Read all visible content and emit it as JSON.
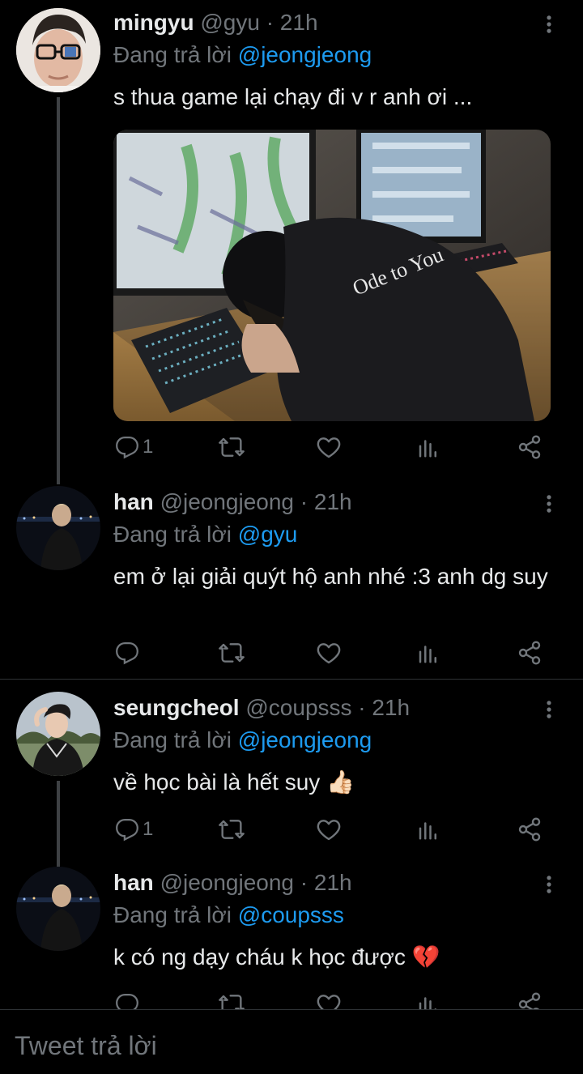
{
  "tweets": [
    {
      "name": "mingyu",
      "handle": "@gyu",
      "time": "· 21h",
      "reply_prefix": "Đang trả lời",
      "reply_to": "@jeongjeong",
      "text": "s thua game lại chạy đi v r anh ơi ...",
      "reply_count": "1",
      "media_text": "Ode to You"
    },
    {
      "name": "han",
      "handle": "@jeongjeong",
      "time": "· 21h",
      "reply_prefix": "Đang trả lời",
      "reply_to": "@gyu",
      "text": "em ở lại giải quýt hộ anh nhé :3 anh dg suy",
      "reply_count": ""
    },
    {
      "name": "seungcheol",
      "handle": "@coupsss",
      "time": "· 21h",
      "reply_prefix": "Đang trả lời",
      "reply_to": "@jeongjeong",
      "text": "về học bài là hết suy 👍🏻",
      "reply_count": "1"
    },
    {
      "name": "han",
      "handle": "@jeongjeong",
      "time": "· 21h",
      "reply_prefix": "Đang trả lời",
      "reply_to": "@coupsss",
      "text": "k có ng dạy cháu k học được 💔",
      "reply_count": ""
    }
  ],
  "composer": {
    "placeholder": "Tweet trả lời"
  },
  "icons": [
    "reply-icon",
    "retweet-icon",
    "like-icon",
    "analytics-icon",
    "share-icon",
    "more-icon"
  ],
  "colors": {
    "background": "#000000",
    "text": "#e7e9ea",
    "muted": "#71767b",
    "accent": "#1d9bf0",
    "line": "#3e4144"
  }
}
